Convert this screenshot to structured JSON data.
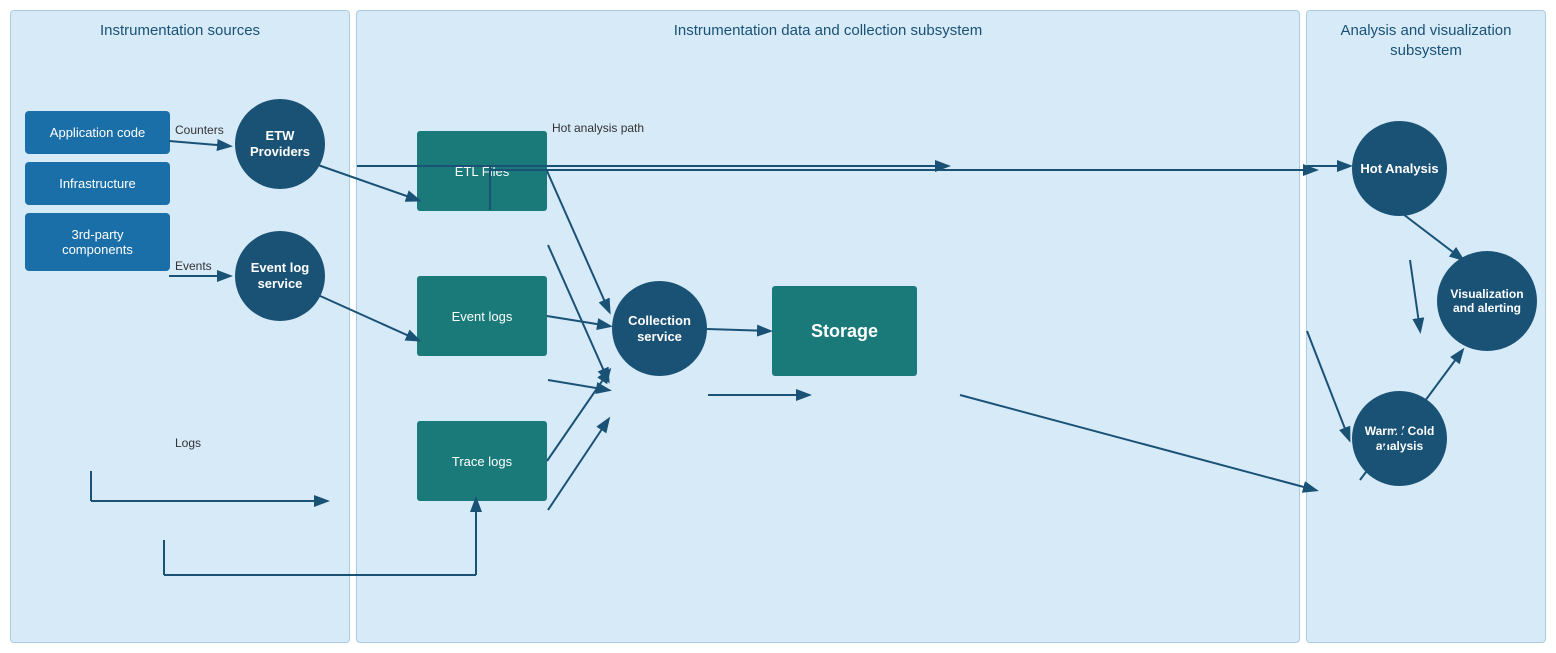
{
  "panels": {
    "left": {
      "title": "Instrumentation sources",
      "sources": [
        "Application code",
        "Infrastructure",
        "3rd-party components"
      ],
      "etw_label": "ETW\nProviders",
      "event_label": "Event log\nservice",
      "counters_label": "Counters",
      "events_label": "Events",
      "logs_label": "Logs"
    },
    "middle": {
      "title": "Instrumentation data and collection subsystem",
      "etl_label": "ETL Files",
      "event_logs_label": "Event logs",
      "trace_logs_label": "Trace logs",
      "collection_label": "Collection\nservice",
      "storage_label": "Storage",
      "hot_path_label": "Hot analysis path"
    },
    "right": {
      "title": "Analysis and visualization\nsubsystem",
      "hot_analysis_label": "Hot Analysis",
      "visualization_label": "Visualization\nand alerting",
      "warm_cold_label": "Warm / Cold\nanalysis"
    }
  },
  "colors": {
    "panel_bg": "#d6eaf8",
    "panel_border": "#a9cde0",
    "title_color": "#1a5276",
    "circle_bg": "#1a5276",
    "box_bg": "#1a7a7a",
    "source_box_bg": "#1a6fa8",
    "arrow_color": "#1a5276"
  }
}
